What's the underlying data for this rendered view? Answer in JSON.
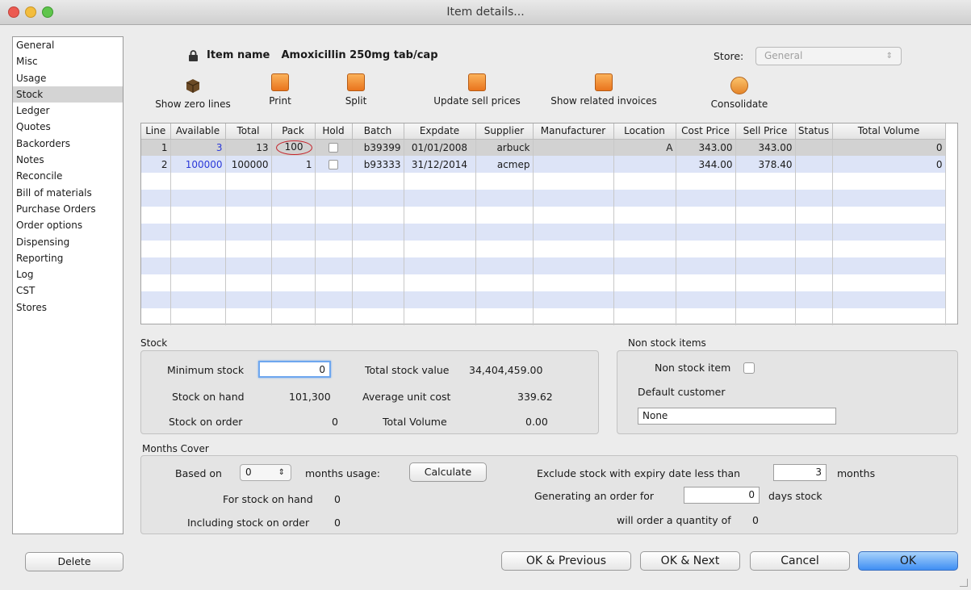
{
  "window": {
    "title": "Item details..."
  },
  "sidebar": {
    "items": [
      "General",
      "Misc",
      "Usage",
      "Stock",
      "Ledger",
      "Quotes",
      "Backorders",
      "Notes",
      "Reconcile",
      "Bill of materials",
      "Purchase Orders",
      "Order options",
      "Dispensing",
      "Reporting",
      "Log",
      "CST",
      "Stores"
    ],
    "selected": "Stock"
  },
  "item": {
    "label": "Item name",
    "name": "Amoxicillin 250mg tab/cap"
  },
  "store": {
    "label": "Store:",
    "value": "General"
  },
  "toolbar": {
    "show_zero_lines": "Show zero lines",
    "print": "Print",
    "split": "Split",
    "update_sell_prices": "Update sell prices",
    "show_related_invoices": "Show related invoices",
    "consolidate": "Consolidate"
  },
  "grid": {
    "columns": [
      "Line",
      "Available",
      "Total",
      "Pack",
      "Hold",
      "Batch",
      "Expdate",
      "Supplier",
      "Manufacturer",
      "Location",
      "Cost Price",
      "Sell Price",
      "Status",
      "Total Volume"
    ],
    "rows": [
      {
        "line": "1",
        "available": "3",
        "total": "13",
        "pack": "100",
        "batch": "b39399",
        "expdate": "01/01/2008",
        "supplier": "arbuck",
        "manufacturer": "",
        "location": "A",
        "cost": "343.00",
        "sell": "343.00",
        "status": "",
        "volume": "0"
      },
      {
        "line": "2",
        "available": "100000",
        "total": "100000",
        "pack": "1",
        "batch": "b93333",
        "expdate": "31/12/2014",
        "supplier": "acmep",
        "manufacturer": "",
        "location": "",
        "cost": "344.00",
        "sell": "378.40",
        "status": "",
        "volume": "0"
      }
    ]
  },
  "stock": {
    "title": "Stock",
    "min_label": "Minimum stock",
    "min_value": "0",
    "soh_label": "Stock on hand",
    "soh_value": "101,300",
    "soo_label": "Stock on order",
    "soo_value": "0",
    "tsv_label": "Total stock value",
    "tsv_value": "34,404,459.00",
    "auc_label": "Average unit cost",
    "auc_value": "339.62",
    "tv_label": "Total Volume",
    "tv_value": "0.00"
  },
  "nonstock": {
    "title": "Non stock items",
    "item_label": "Non stock item",
    "customer_label": "Default customer",
    "customer_value": "None"
  },
  "months": {
    "title": "Months Cover",
    "based_on": "Based on",
    "based_value": "0",
    "usage_label": "months usage:",
    "calculate": "Calculate",
    "for_soh": "For stock on hand",
    "for_soh_value": "0",
    "incl_soo": "Including stock on order",
    "incl_soo_value": "0",
    "exclude_label": "Exclude stock with expiry date less than",
    "exclude_value": "3",
    "exclude_unit": "months",
    "gen_label": "Generating an order for",
    "gen_value": "0",
    "gen_unit": "days stock",
    "will_order": "will order a quantity of",
    "will_order_value": "0"
  },
  "buttons": {
    "delete": "Delete",
    "ok_prev": "OK & Previous",
    "ok_next": "OK & Next",
    "cancel": "Cancel",
    "ok": "OK"
  }
}
